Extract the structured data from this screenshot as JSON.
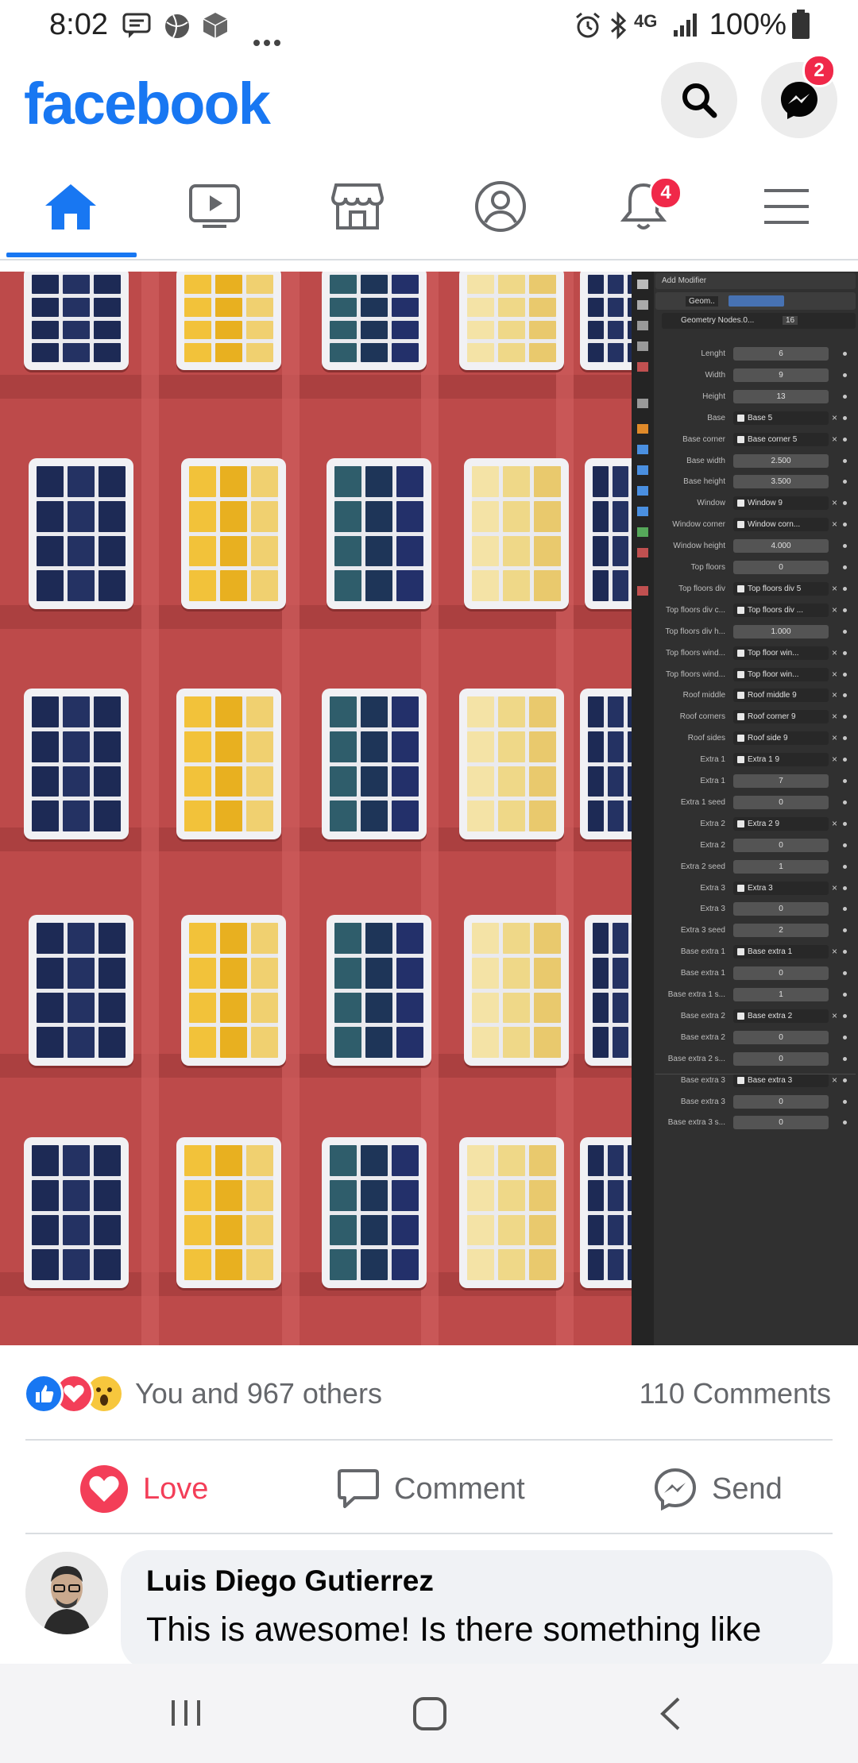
{
  "status_bar": {
    "time": "8:02",
    "battery": "100%",
    "network": "4G"
  },
  "header": {
    "logo": "facebook",
    "messenger_badge": "2"
  },
  "nav": {
    "notifications_badge": "4",
    "active_tab": "home"
  },
  "media": {
    "panel_header": "Add Modifier",
    "modifier_name": "Geom..",
    "node_group": "Geometry Nodes.0...",
    "node_users": "16",
    "rows": [
      {
        "label": "Lenght",
        "value": "6",
        "type": "num"
      },
      {
        "label": "Width",
        "value": "9",
        "type": "num"
      },
      {
        "label": "Height",
        "value": "13",
        "type": "num"
      },
      {
        "label": "Base",
        "value": "Base 5",
        "type": "obj"
      },
      {
        "label": "Base corner",
        "value": "Base corner 5",
        "type": "obj"
      },
      {
        "label": "Base width",
        "value": "2.500",
        "type": "num"
      },
      {
        "label": "Base height",
        "value": "3.500",
        "type": "num"
      },
      {
        "label": "Window",
        "value": "Window 9",
        "type": "obj"
      },
      {
        "label": "Window corner",
        "value": "Window corn...",
        "type": "obj"
      },
      {
        "label": "Window height",
        "value": "4.000",
        "type": "num"
      },
      {
        "label": "Top floors",
        "value": "0",
        "type": "num"
      },
      {
        "label": "Top floors div",
        "value": "Top floors div 5",
        "type": "obj"
      },
      {
        "label": "Top floors div c...",
        "value": "Top floors div ...",
        "type": "obj"
      },
      {
        "label": "Top floors div h...",
        "value": "1.000",
        "type": "num"
      },
      {
        "label": "Top floors wind...",
        "value": "Top floor win...",
        "type": "obj"
      },
      {
        "label": "Top floors wind...",
        "value": "Top floor win...",
        "type": "obj"
      },
      {
        "label": "Roof middle",
        "value": "Roof middle 9",
        "type": "obj"
      },
      {
        "label": "Roof corners",
        "value": "Roof corner 9",
        "type": "obj"
      },
      {
        "label": "Roof sides",
        "value": "Roof side 9",
        "type": "obj"
      },
      {
        "label": "Extra 1",
        "value": "Extra 1 9",
        "type": "obj"
      },
      {
        "label": "Extra 1",
        "value": "7",
        "type": "num"
      },
      {
        "label": "Extra 1 seed",
        "value": "0",
        "type": "num"
      },
      {
        "label": "Extra 2",
        "value": "Extra 2 9",
        "type": "obj"
      },
      {
        "label": "Extra 2",
        "value": "0",
        "type": "num"
      },
      {
        "label": "Extra 2 seed",
        "value": "1",
        "type": "num"
      },
      {
        "label": "Extra 3",
        "value": "Extra 3",
        "type": "obj"
      },
      {
        "label": "Extra 3",
        "value": "0",
        "type": "num"
      },
      {
        "label": "Extra 3 seed",
        "value": "2",
        "type": "num"
      },
      {
        "label": "Base extra 1",
        "value": "Base extra 1",
        "type": "obj"
      },
      {
        "label": "Base extra 1",
        "value": "0",
        "type": "num"
      },
      {
        "label": "Base extra 1 s...",
        "value": "1",
        "type": "num"
      },
      {
        "label": "Base extra 2",
        "value": "Base extra 2",
        "type": "obj"
      },
      {
        "label": "Base extra 2",
        "value": "0",
        "type": "num"
      },
      {
        "label": "Base extra 2 s...",
        "value": "0",
        "type": "num"
      },
      {
        "label": "Base extra 3",
        "value": "Base extra 3",
        "type": "obj"
      },
      {
        "label": "Base extra 3",
        "value": "0",
        "type": "num"
      },
      {
        "label": "Base extra 3 s...",
        "value": "0",
        "type": "num"
      }
    ]
  },
  "reactions": {
    "summary": "You and 967 others",
    "comments": "110 Comments"
  },
  "actions": {
    "love": "Love",
    "comment": "Comment",
    "send": "Send"
  },
  "comment": {
    "author": "Luis Diego Gutierrez",
    "text": "This is awesome! Is there something like"
  },
  "colors": {
    "brand": "#1877f2",
    "love": "#f33e58",
    "badge": "#f02849"
  }
}
